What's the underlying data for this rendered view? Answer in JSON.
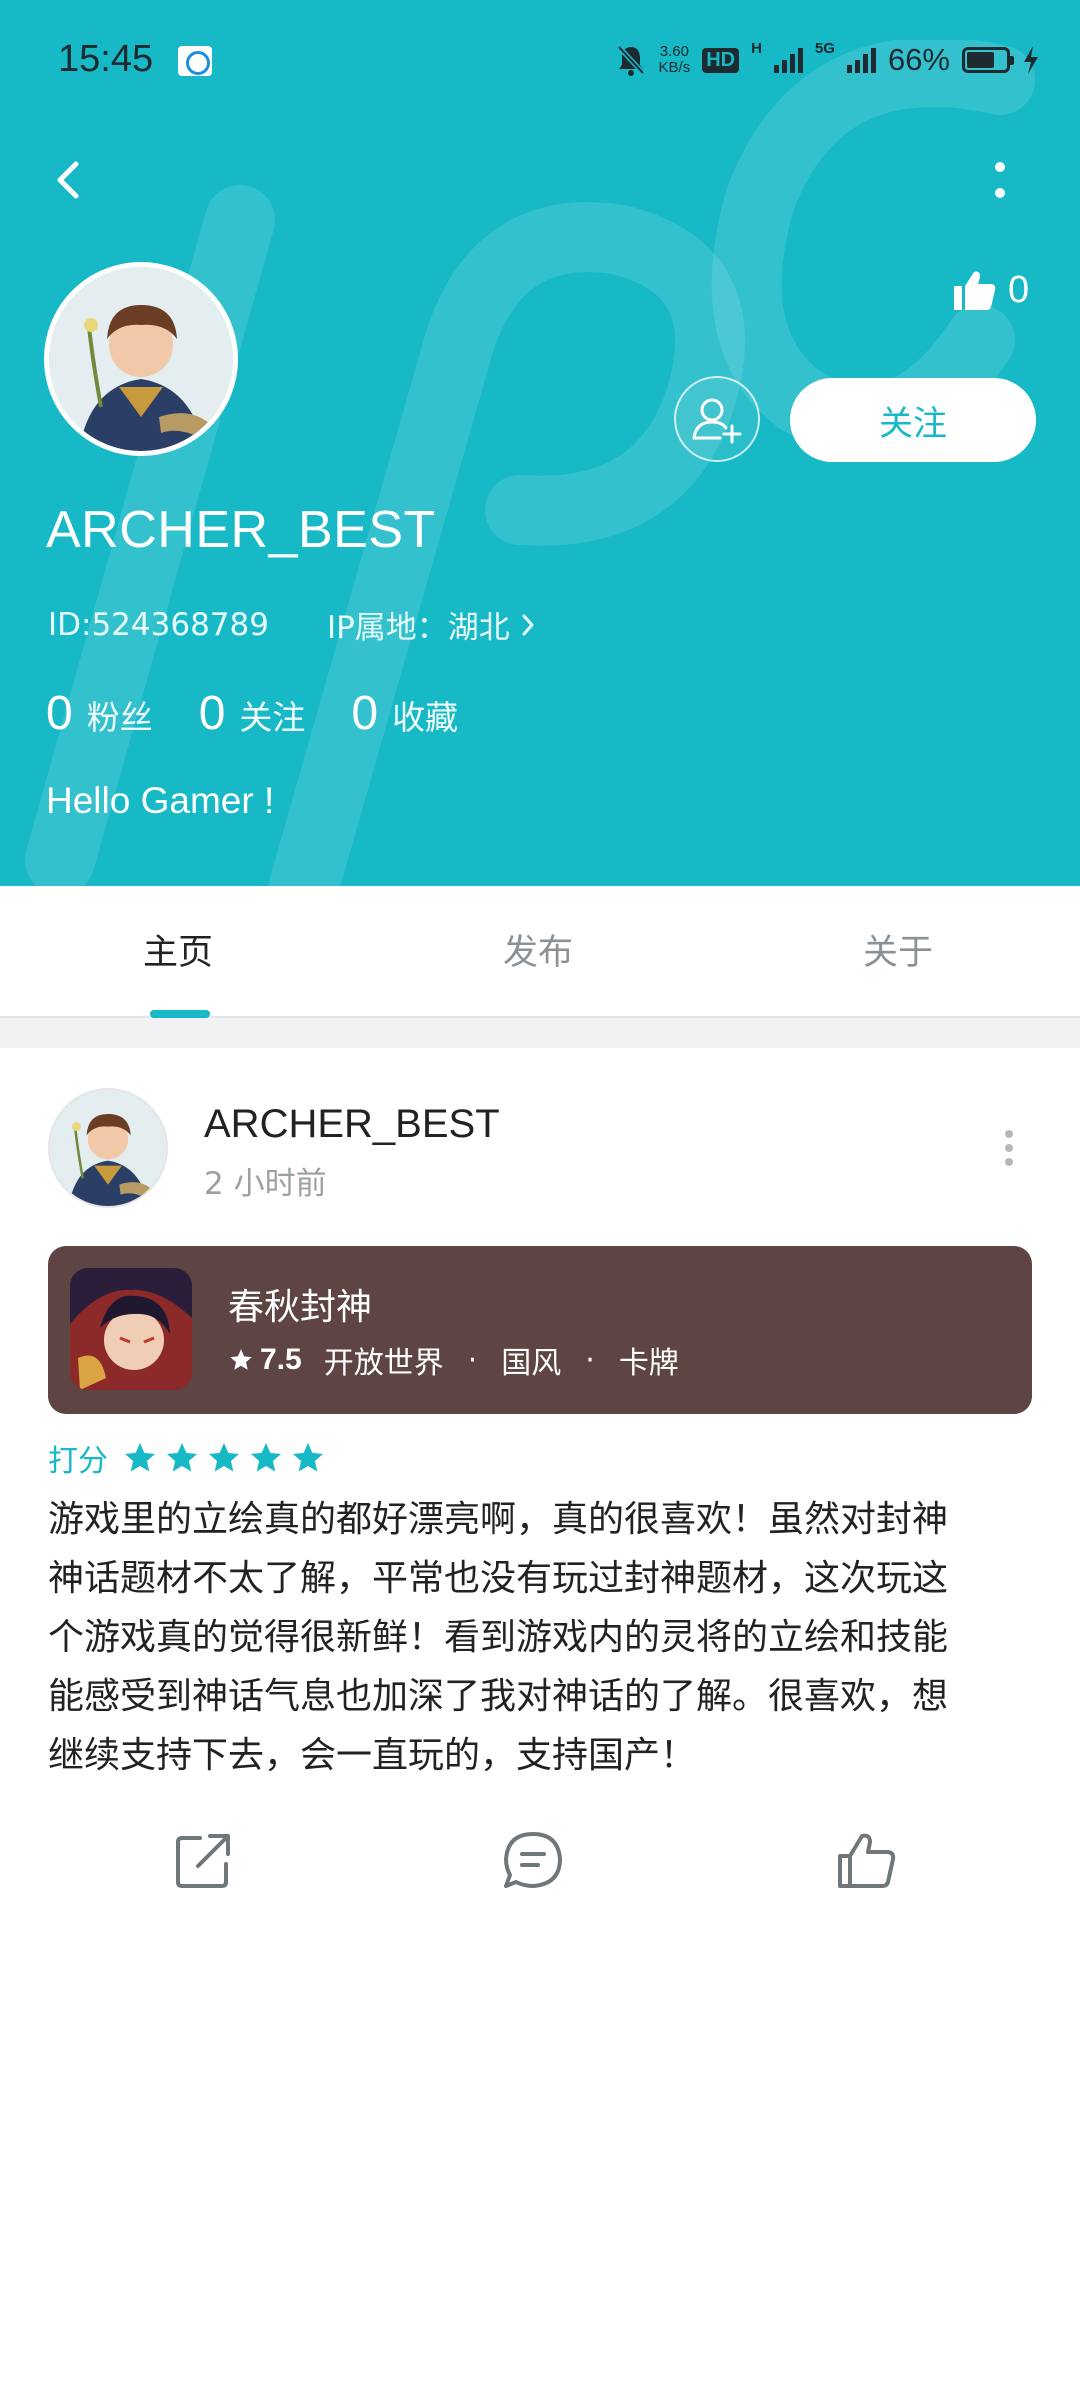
{
  "status_bar": {
    "time": "15:45",
    "net_speed": "3.60",
    "net_speed_unit": "KB/s",
    "hd_badge": "HD",
    "net_type_1": "H",
    "net_type_2": "5G",
    "battery": "66%"
  },
  "profile": {
    "username": "ARCHER_BEST",
    "id_text": "ID:524368789",
    "ip_text": "IP属地：湖北",
    "likes": "0",
    "follow_button": "关注",
    "stats": [
      {
        "num": "0",
        "label": "粉丝"
      },
      {
        "num": "0",
        "label": "关注"
      },
      {
        "num": "0",
        "label": "收藏"
      }
    ],
    "bio": "Hello Gamer !"
  },
  "tabs": [
    "主页",
    "发布",
    "关于"
  ],
  "active_tab": "主页",
  "post": {
    "author": "ARCHER_BEST",
    "time": "2 小时前",
    "game": {
      "name": "春秋封神",
      "score": "7.5",
      "tags": [
        "开放世界",
        "国风",
        "卡牌"
      ]
    },
    "rating_label": "打分",
    "rating_stars": 5,
    "review_lines": [
      "游戏里的立绘真的都好漂亮啊，真的很喜欢！虽然对封神",
      "神话题材不太了解，平常也没有玩过封神题材，这次玩这",
      "个游戏真的觉得很新鲜！看到游戏内的灵将的立绘和技能",
      "能感受到神话气息也加深了我对神话的了解。很喜欢，想",
      "继续支持下去，会一直玩的，支持国产！"
    ]
  },
  "colors": {
    "accent": "#17b9c6",
    "game_card": "#5e4442",
    "star": "#17b9c6"
  }
}
